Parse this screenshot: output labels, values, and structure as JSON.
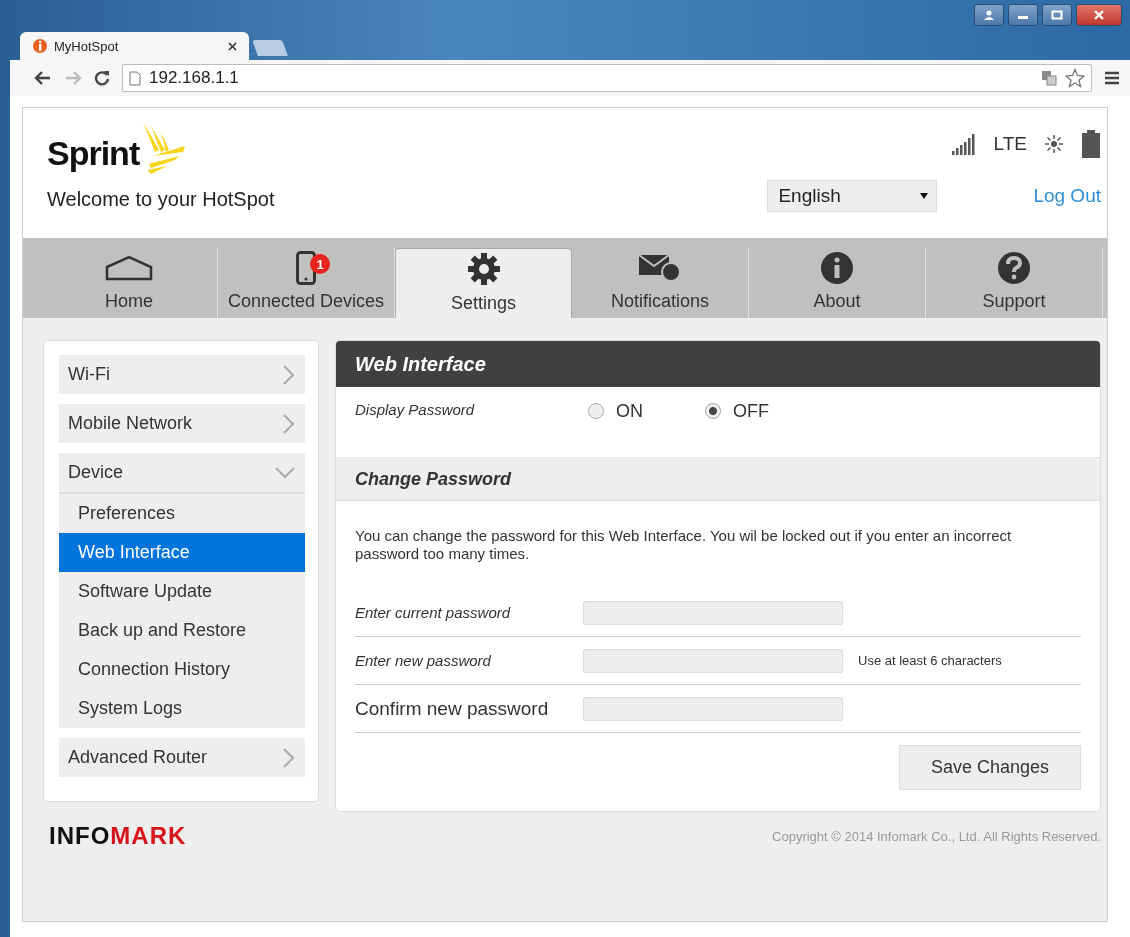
{
  "browser": {
    "tab_title": "MyHotSpot",
    "address": "192.168.1.1"
  },
  "header": {
    "brand": "Sprint",
    "welcome": "Welcome to your HotSpot",
    "status": {
      "network": "LTE"
    },
    "language": "English",
    "logout": "Log Out"
  },
  "nav": [
    {
      "label": "Home",
      "kind": "home",
      "selected": false
    },
    {
      "label": "Connected Devices",
      "kind": "devices",
      "badge": "1",
      "selected": false
    },
    {
      "label": "Settings",
      "kind": "settings",
      "selected": true
    },
    {
      "label": "Notifications",
      "kind": "notifications",
      "selected": false
    },
    {
      "label": "About",
      "kind": "about",
      "selected": false
    },
    {
      "label": "Support",
      "kind": "support",
      "selected": false
    }
  ],
  "sidebar": [
    {
      "label": "Wi-Fi",
      "expanded": false
    },
    {
      "label": "Mobile Network",
      "expanded": false
    },
    {
      "label": "Device",
      "expanded": true,
      "children": [
        {
          "label": "Preferences",
          "selected": false
        },
        {
          "label": "Web Interface",
          "selected": true
        },
        {
          "label": "Software Update",
          "selected": false
        },
        {
          "label": "Back up and Restore",
          "selected": false
        },
        {
          "label": "Connection History",
          "selected": false
        },
        {
          "label": "System Logs",
          "selected": false
        }
      ]
    },
    {
      "label": "Advanced Router",
      "expanded": false
    }
  ],
  "panel": {
    "title": "Web Interface",
    "display_password": {
      "label": "Display Password",
      "options": [
        {
          "label": "ON",
          "selected": false
        },
        {
          "label": "OFF",
          "selected": true
        }
      ]
    },
    "section_title": "Change Password",
    "description": "You can change the password for this Web Interface. You wil be locked out if you enter an incorrect password too many times.",
    "fields": [
      {
        "label": "Enter current password",
        "italic": true
      },
      {
        "label": "Enter new password",
        "italic": true,
        "hint": "Use at least 6 characters"
      },
      {
        "label": "Confirm new password",
        "italic": false
      }
    ],
    "save": "Save Changes"
  },
  "footer": {
    "logo_first": "INFO",
    "logo_second": "MARK",
    "copyright": "Copyright © 2014 Infomark Co., Ltd. All Rights Reserved."
  }
}
